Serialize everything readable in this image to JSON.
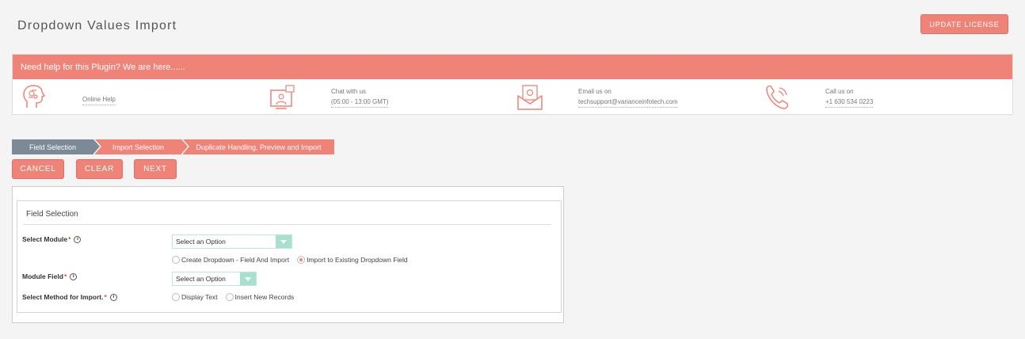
{
  "page": {
    "title": "Dropdown Values Import"
  },
  "header": {
    "update_license_label": "UPDATE LICENSE"
  },
  "help": {
    "header_text": "Need help for this Plugin? We are here......",
    "online_help": {
      "label": "Online Help",
      "icon": "brain-head-icon"
    },
    "chat": {
      "label": "Chat with us",
      "value": "(05:00 - 13:00 GMT)",
      "icon": "chat-monitor-icon"
    },
    "email": {
      "label": "Email us on",
      "value": "techsupport@varianceinfotech.com",
      "icon": "email-envelope-icon"
    },
    "call": {
      "label": "Call us on",
      "value": "+1 630 534 0223",
      "icon": "phone-icon"
    }
  },
  "wizard": {
    "steps": [
      {
        "label": "Field Selection",
        "active": true
      },
      {
        "label": "Import Selection",
        "active": false
      },
      {
        "label": "Duplicate Handling, Preview and Import",
        "active": false
      }
    ]
  },
  "actions": {
    "cancel": "CANCEL",
    "clear": "CLEAR",
    "next": "NEXT"
  },
  "form": {
    "section_title": "Field Selection",
    "select_module": {
      "label": "Select Module",
      "required": "*",
      "value": "Select an Option"
    },
    "import_type": {
      "options": [
        {
          "label": "Create Dropdown - Field And Import",
          "checked": false
        },
        {
          "label": "Import to Existing Dropdown Field",
          "checked": true
        }
      ]
    },
    "module_field": {
      "label": "Module Field",
      "required": "*",
      "value": "Select an Option"
    },
    "import_method": {
      "label": "Select Method for Import.",
      "required": "*",
      "options": [
        {
          "label": "Display Text",
          "checked": false
        },
        {
          "label": "Insert New Records",
          "checked": false
        }
      ]
    },
    "info_glyph": "i"
  },
  "colors": {
    "accent": "#f08377",
    "active_step": "#7b8a96",
    "select_arrow": "#a8e0cf"
  }
}
